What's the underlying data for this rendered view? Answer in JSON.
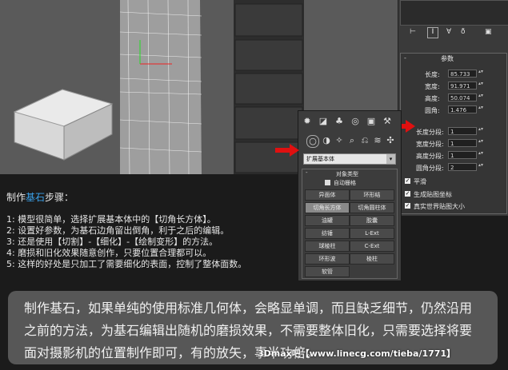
{
  "params_panel": {
    "title": "参数",
    "length_label": "长度:",
    "length_value": "85.733",
    "width_label": "宽度:",
    "width_value": "91.971",
    "height_label": "高度:",
    "height_value": "50.074",
    "fillet_label": "圆角:",
    "fillet_value": "1.476",
    "length_segs_label": "长度分段:",
    "length_segs_value": "1",
    "width_segs_label": "宽度分段:",
    "width_segs_value": "1",
    "height_segs_label": "高度分段:",
    "height_segs_value": "1",
    "fillet_segs_label": "圆角分段:",
    "fillet_segs_value": "2",
    "smooth_label": "平滑",
    "gen_map_label": "生成贴图坐标",
    "real_world_label": "真实世界贴图大小"
  },
  "command_panel": {
    "dropdown_value": "扩展基本体",
    "object_type_title": "对象类型",
    "autogrid_label": "自动栅格",
    "buttons": [
      "异面体",
      "环形结",
      "切角长方体",
      "切角圆柱体",
      "油罐",
      "胶囊",
      "纺锤",
      "L-Ext",
      "球棱柱",
      "C-Ext",
      "环形波",
      "棱柱",
      "软管"
    ]
  },
  "heading": {
    "prefix": "制作",
    "highlight": "基石",
    "suffix": "步骤："
  },
  "steps": [
    "1: 模型很简单，选择扩展基本体中的【切角长方体】。",
    "2: 设置好参数，为基石边角留出倒角，利于之后的编辑。",
    "3: 还是使用【切割】-【细化】-【绘制变形】的方法。",
    "4: 磨损和旧化效果随意创作，只要位置合理都可以。",
    "5: 这样的好处是只加工了需要细化的表面，控制了整体面数。"
  ],
  "caption": {
    "line1": "制作基石，如果单纯的使用标准几何体，会略显单调，而且缺乏细节，仍然沿用",
    "line2": "之前的方法，为基石编辑出随机的磨损效果，不需要整体旧化，只需要选择将要",
    "line3": "面对摄影机的位置制作即可，有的放矢，事半功倍。"
  },
  "watermark": "3Dmax吧【www.linecg.com/tieba/1771】",
  "colors": {
    "accent_blue": "#3aa0e8",
    "arrow_red": "#e01010",
    "caption_bg": "#575757"
  }
}
